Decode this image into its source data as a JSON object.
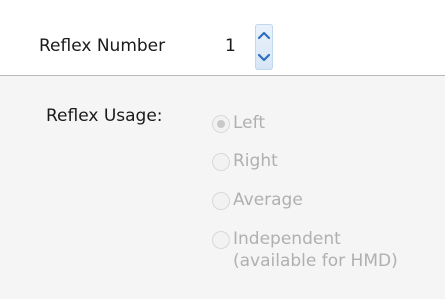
{
  "reflex_number": {
    "label": "Reflex Number",
    "value": "1"
  },
  "reflex_usage": {
    "label": "Reflex Usage:",
    "options": [
      {
        "label": "Left",
        "selected": true,
        "enabled": false
      },
      {
        "label": "Right",
        "selected": false,
        "enabled": false
      },
      {
        "label": "Average",
        "selected": false,
        "enabled": false
      },
      {
        "label": "Independent",
        "sublabel": "(available for HMD)",
        "selected": false,
        "enabled": false
      }
    ]
  },
  "icons": {
    "spinner_up": "chevron-up-icon",
    "spinner_down": "chevron-down-icon"
  },
  "colors": {
    "background": "#f5f5f5",
    "top_panel": "#ffffff",
    "divider": "#b9b9b9",
    "text": "#1a1a1a",
    "disabled_text": "#b0b0b0",
    "spinner_bg": "#dbe8f7",
    "spinner_arrow": "#2f6fbe"
  }
}
